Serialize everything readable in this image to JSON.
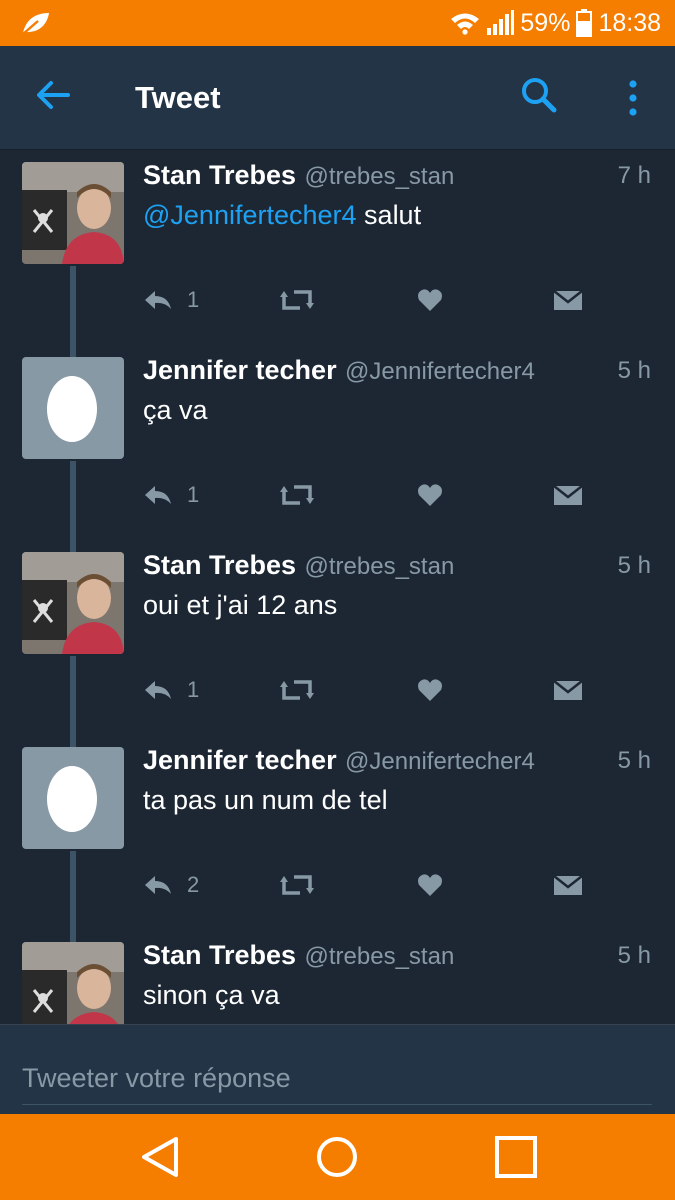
{
  "status_bar": {
    "battery": "59%",
    "time": "18:38",
    "icons": [
      "leaf-icon",
      "wifi-icon",
      "signal-icon",
      "battery-icon"
    ]
  },
  "app_bar": {
    "title": "Tweet",
    "icons": [
      "back-arrow-icon",
      "search-icon",
      "more-vertical-icon"
    ]
  },
  "tweets": [
    {
      "name": "Stan Trebes",
      "handle": "@trebes_stan",
      "time": "7 h",
      "mention": "@Jennifertecher4",
      "text": "salut",
      "replies": "1",
      "avatar": "photo"
    },
    {
      "name": "Jennifer techer",
      "handle": "@Jennifertecher4",
      "time": "5 h",
      "mention": "",
      "text": "ça va",
      "replies": "1",
      "avatar": "egg"
    },
    {
      "name": "Stan Trebes",
      "handle": "@trebes_stan",
      "time": "5 h",
      "mention": "",
      "text": "oui et j'ai 12 ans",
      "replies": "1",
      "avatar": "photo"
    },
    {
      "name": "Jennifer techer",
      "handle": "@Jennifertecher4",
      "time": "5 h",
      "mention": "",
      "text": "ta pas un num de tel",
      "replies": "2",
      "avatar": "egg"
    },
    {
      "name": "Stan Trebes",
      "handle": "@trebes_stan",
      "time": "5 h",
      "mention": "",
      "text": "sinon ça va",
      "replies": "",
      "avatar": "photo"
    }
  ],
  "composer": {
    "placeholder": "Tweeter votre réponse"
  },
  "nav_bar": {
    "icons": [
      "back-triangle-icon",
      "home-circle-icon",
      "recents-square-icon"
    ]
  },
  "colors": {
    "accent": "#1da1f2",
    "system_bar": "#f57d00",
    "background": "#1c2733",
    "header": "#243447"
  }
}
